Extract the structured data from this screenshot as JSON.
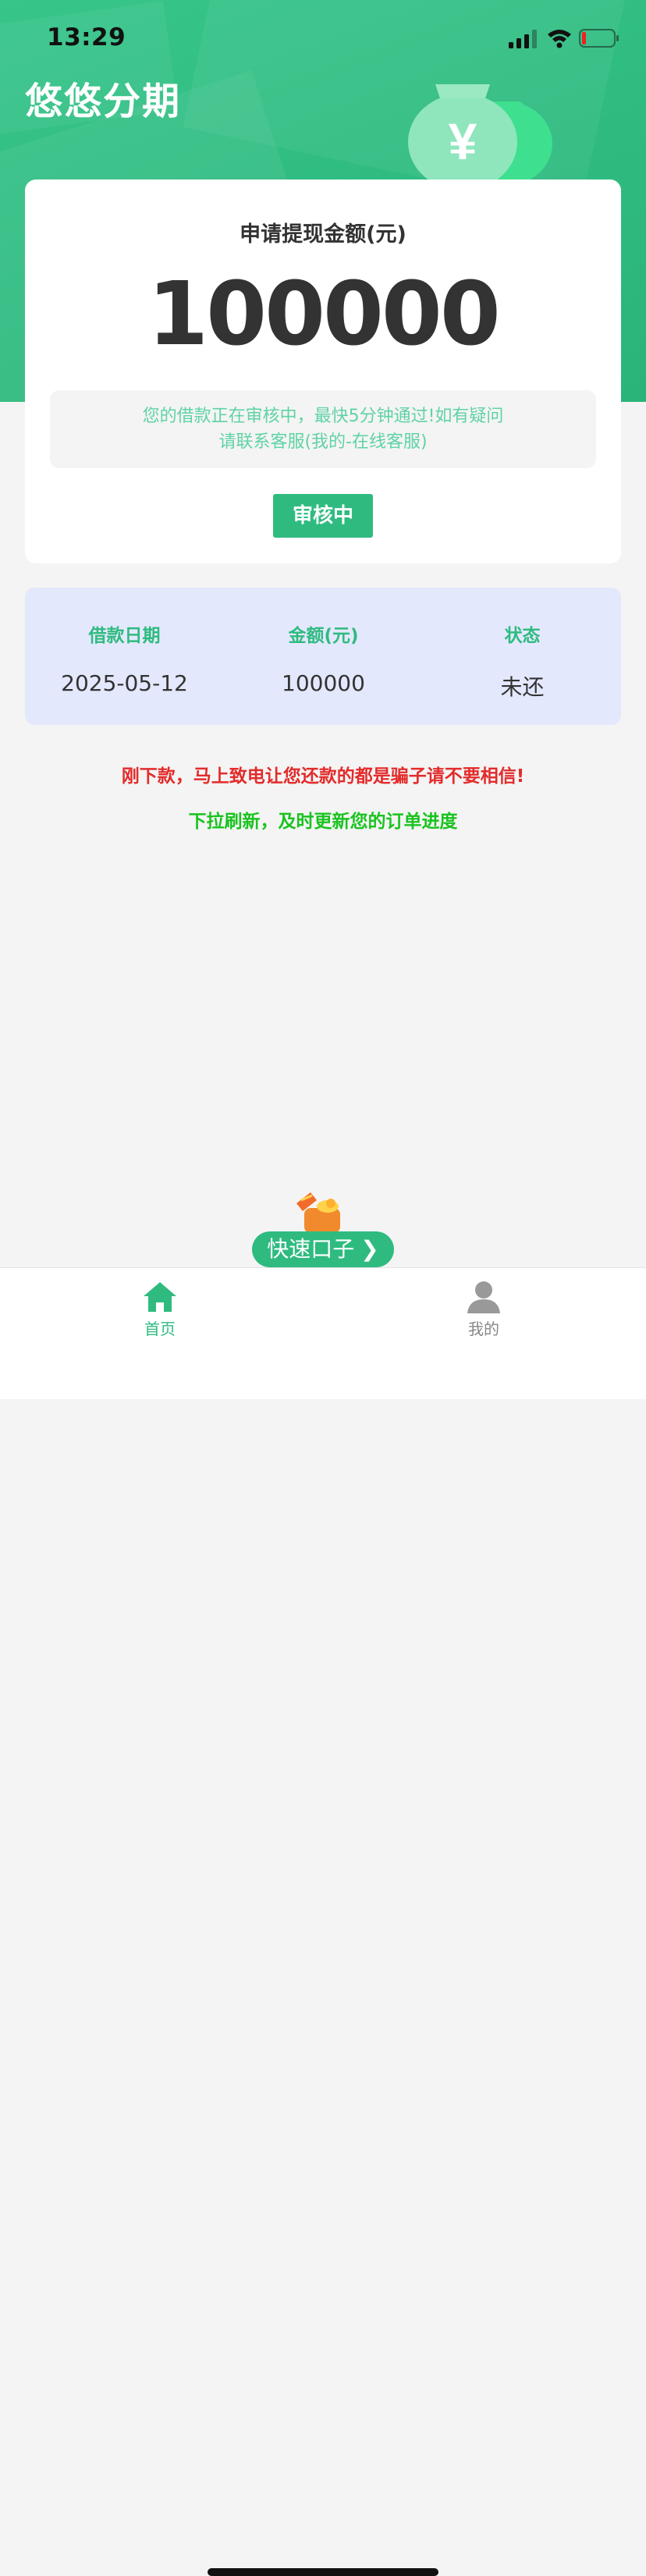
{
  "status_bar": {
    "time": "13:29"
  },
  "header": {
    "app_title": "悠悠分期"
  },
  "loan_card": {
    "title": "申请提现金额(元)",
    "amount": "100000",
    "notice_line1": "您的借款正在审核中，最快5分钟通过!如有疑问",
    "notice_line2": "请联系客服(我的-在线客服)",
    "status_button": "审核中"
  },
  "records_table": {
    "headers": [
      "借款日期",
      "金额(元)",
      "状态"
    ],
    "row": [
      "2025-05-12",
      "100000",
      "未还"
    ]
  },
  "messages": {
    "warning": "刚下款，马上致电让您还款的都是骗子请不要相信!",
    "refresh": "下拉刷新，及时更新您的订单进度"
  },
  "floating_button": {
    "label": "快速口子"
  },
  "tab_bar": {
    "items": [
      {
        "label": "首页",
        "icon": "home-icon",
        "active": true
      },
      {
        "label": "我的",
        "icon": "user-icon",
        "active": false
      }
    ]
  },
  "colors": {
    "primary_green": "#2fbb80",
    "notice_text": "#5fd3a4",
    "warning_red": "#e32b2b",
    "refresh_green": "#19c31f",
    "table_bg": "#e4e8fd"
  }
}
